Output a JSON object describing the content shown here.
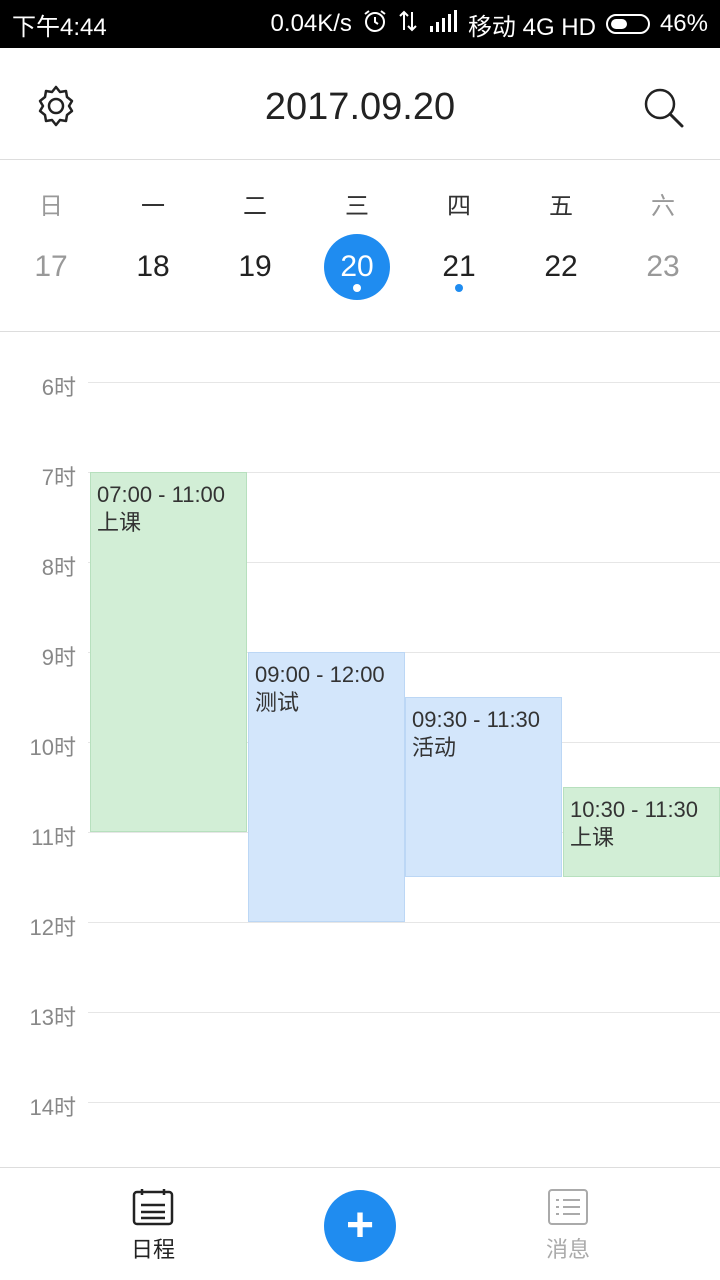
{
  "statusbar": {
    "time": "下午4:44",
    "net_speed": "0.04K/s",
    "carrier": "移动 4G HD",
    "battery": "46%",
    "battery_level": 0.46
  },
  "header": {
    "title": "2017.09.20",
    "settings_icon": "gear-icon",
    "search_icon": "search-icon"
  },
  "week": {
    "days": [
      {
        "dow": "日",
        "num": "17",
        "weekend": true,
        "selected": false,
        "has_event": false
      },
      {
        "dow": "一",
        "num": "18",
        "weekend": false,
        "selected": false,
        "has_event": false
      },
      {
        "dow": "二",
        "num": "19",
        "weekend": false,
        "selected": false,
        "has_event": false
      },
      {
        "dow": "三",
        "num": "20",
        "weekend": false,
        "selected": true,
        "has_event": true
      },
      {
        "dow": "四",
        "num": "21",
        "weekend": false,
        "selected": false,
        "has_event": true
      },
      {
        "dow": "五",
        "num": "22",
        "weekend": false,
        "selected": false,
        "has_event": false
      },
      {
        "dow": "六",
        "num": "23",
        "weekend": true,
        "selected": false,
        "has_event": false
      }
    ],
    "accent_color": "#1f8cf0"
  },
  "timeline": {
    "hours": [
      "6时",
      "7时",
      "8时",
      "9时",
      "10时",
      "11时",
      "12时",
      "13时",
      "14时"
    ],
    "events": [
      {
        "time": "07:00 - 11:00",
        "title": "上课",
        "color": "green"
      },
      {
        "time": "09:00 - 12:00",
        "title": "测试",
        "color": "blue"
      },
      {
        "time": "09:30 - 11:30",
        "title": "活动",
        "color": "blue"
      },
      {
        "time": "10:30 - 11:30",
        "title": "上课",
        "color": "green"
      }
    ]
  },
  "bottom_nav": {
    "schedule_label": "日程",
    "messages_label": "消息",
    "add_label": "+"
  }
}
